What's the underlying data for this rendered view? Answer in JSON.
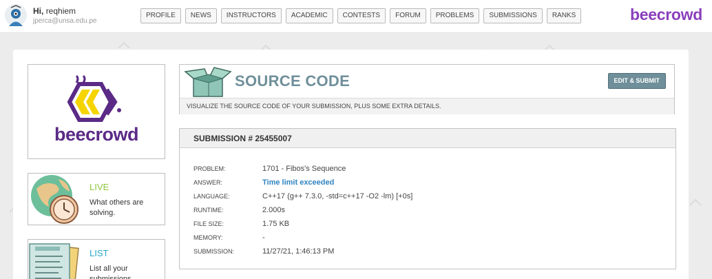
{
  "user": {
    "greeting_prefix": "Hi,",
    "name": "reqhiem",
    "email": "jperca@unsa.edu.pe"
  },
  "nav": [
    {
      "label": "PROFILE"
    },
    {
      "label": "NEWS"
    },
    {
      "label": "INSTRUCTORS"
    },
    {
      "label": "ACADEMIC"
    },
    {
      "label": "CONTESTS"
    },
    {
      "label": "FORUM"
    },
    {
      "label": "PROBLEMS"
    },
    {
      "label": "SUBMISSIONS"
    },
    {
      "label": "RANKS"
    }
  ],
  "brand": "beecrowd",
  "sidebar": {
    "logo_text": "beecrowd",
    "cards": [
      {
        "title": "LIVE",
        "description": "What others are solving.",
        "color": "#8cc63f"
      },
      {
        "title": "LIST",
        "description": "List all your submissions.",
        "color": "#2aa7c9"
      }
    ]
  },
  "source_code": {
    "title": "SOURCE CODE",
    "edit_button": "EDIT & SUBMIT",
    "subtitle": "VISUALIZE THE SOURCE CODE OF YOUR SUBMISSION, PLUS SOME EXTRA DETAILS."
  },
  "submission": {
    "header": "SUBMISSION # 25455007",
    "rows": [
      {
        "label": "PROBLEM:",
        "value": "1701 - Fibos's Sequence"
      },
      {
        "label": "ANSWER:",
        "value": "Time limit exceeded"
      },
      {
        "label": "LANGUAGE:",
        "value": "C++17 (g++ 7.3.0, -std=c++17 -O2 -lm) [+0s]"
      },
      {
        "label": "RUNTIME:",
        "value": "2.000s"
      },
      {
        "label": "FILE SIZE:",
        "value": "1.75 KB"
      },
      {
        "label": "MEMORY:",
        "value": "-"
      },
      {
        "label": "SUBMISSION:",
        "value": "11/27/21, 1:46:13 PM"
      }
    ]
  },
  "colors": {
    "brand_purple": "#8a3fbb",
    "accent_teal": "#6f8f9a",
    "answer_blue": "#2f84c2"
  }
}
